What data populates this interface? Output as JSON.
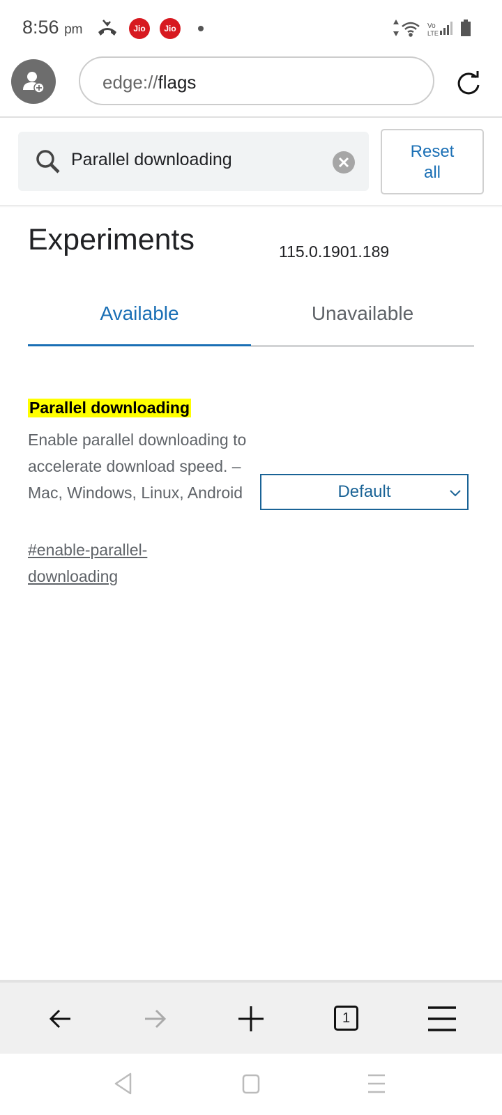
{
  "status_bar": {
    "time": "8:56",
    "ampm": "pm",
    "carrier_badges": [
      "Jio",
      "Jio"
    ],
    "icons": [
      "missed-call-icon",
      "jio-icon",
      "jio-icon",
      "dot-icon",
      "data-arrows-icon",
      "wifi-icon",
      "volte-icon",
      "signal-icon",
      "battery-icon"
    ]
  },
  "address_bar": {
    "scheme": "edge://",
    "host": "flags"
  },
  "search": {
    "value": "Parallel downloading",
    "reset_label_line1": "Reset",
    "reset_label_line2": "all"
  },
  "page": {
    "title": "Experiments",
    "version": "115.0.1901.189"
  },
  "tabs": [
    {
      "label": "Available",
      "active": true
    },
    {
      "label": "Unavailable",
      "active": false
    }
  ],
  "flag": {
    "title": "Parallel downloading",
    "description": "Enable parallel downloading to accelerate download speed. – Mac, Windows, Linux, Android",
    "link": "#enable-parallel-downloading",
    "selected_option": "Default"
  },
  "toolbar": {
    "tab_count": "1"
  },
  "colors": {
    "accent": "#1a6fb5",
    "highlight": "#ffff00",
    "jio_red": "#d71920"
  }
}
